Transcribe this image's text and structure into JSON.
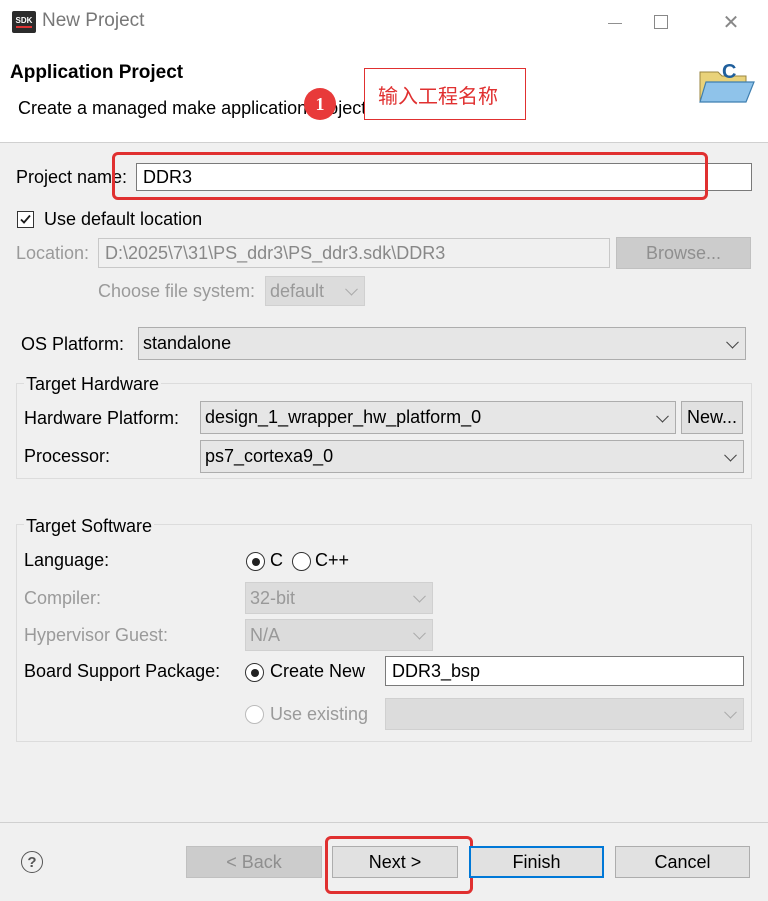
{
  "window": {
    "title": "New Project",
    "app_icon_text": "SDK",
    "minimize_glyph": "—",
    "maximize_glyph": "☐",
    "close_glyph": "✕"
  },
  "header": {
    "title": "Application Project",
    "subtitle": "Create a managed make application project."
  },
  "annotation": {
    "badge": "1",
    "text": "输入工程名称",
    "color": "#e03030"
  },
  "project": {
    "name_label": "Project name:",
    "name_value": "DDR3",
    "use_default_location_label": "Use default location",
    "use_default_location_checked": true,
    "location_label": "Location:",
    "location_value": "D:\\2025\\7\\31\\PS_ddr3\\PS_ddr3.sdk\\DDR3",
    "browse_label": "Browse...",
    "file_system_label": "Choose file system:",
    "file_system_value": "default"
  },
  "os_platform": {
    "label": "OS Platform:",
    "value": "standalone"
  },
  "target_hardware": {
    "group_label": "Target Hardware",
    "hardware_platform_label": "Hardware Platform:",
    "hardware_platform_value": "design_1_wrapper_hw_platform_0",
    "new_label": "New...",
    "processor_label": "Processor:",
    "processor_value": "ps7_cortexa9_0"
  },
  "target_software": {
    "group_label": "Target Software",
    "language_label": "Language:",
    "language_options": [
      "C",
      "C++"
    ],
    "language_selected": "C",
    "compiler_label": "Compiler:",
    "compiler_value": "32-bit",
    "hypervisor_label": "Hypervisor Guest:",
    "hypervisor_value": "N/A",
    "bsp_label": "Board Support Package:",
    "create_new_label": "Create New",
    "bsp_name_value": "DDR3_bsp",
    "use_existing_label": "Use existing",
    "use_existing_value": ""
  },
  "footer": {
    "help_glyph": "?",
    "back_label": "< Back",
    "next_label": "Next >",
    "finish_label": "Finish",
    "cancel_label": "Cancel"
  },
  "colors": {
    "accent": "#0078d7",
    "annotation_red": "#e03030"
  }
}
